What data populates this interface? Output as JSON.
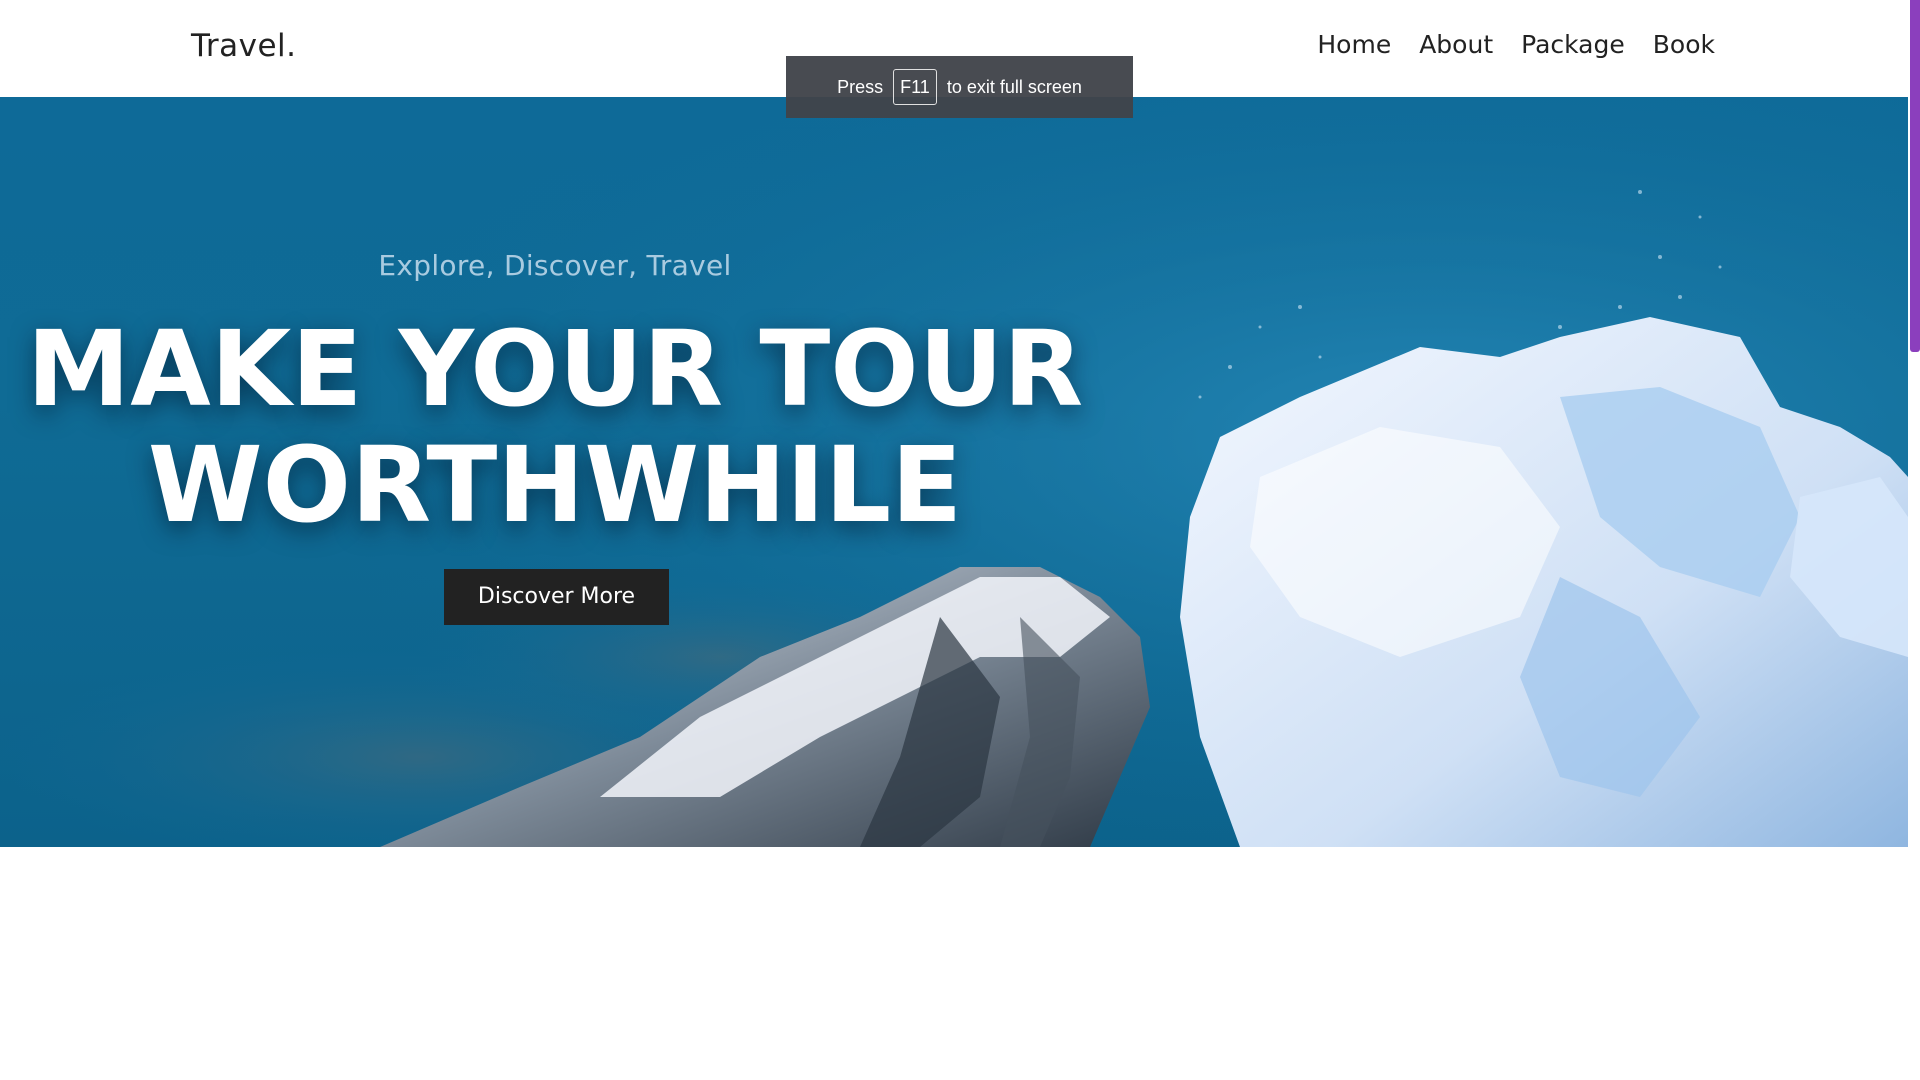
{
  "header": {
    "logo": "Travel.",
    "nav": [
      {
        "label": "Home"
      },
      {
        "label": "About"
      },
      {
        "label": "Package"
      },
      {
        "label": "Book"
      }
    ]
  },
  "fullscreen_toast": {
    "prefix": "Press",
    "key": "F11",
    "suffix": "to exit full screen"
  },
  "hero": {
    "tagline": "Explore, Discover, Travel",
    "headline_line1": "MAKE YOUR TOUR",
    "headline_line2": "WORTHWHILE",
    "cta_label": "Discover More"
  },
  "colors": {
    "accent_scrollbar": "#8b3fbd",
    "hero_water": "#0e6a98",
    "cta_background": "#222222"
  }
}
